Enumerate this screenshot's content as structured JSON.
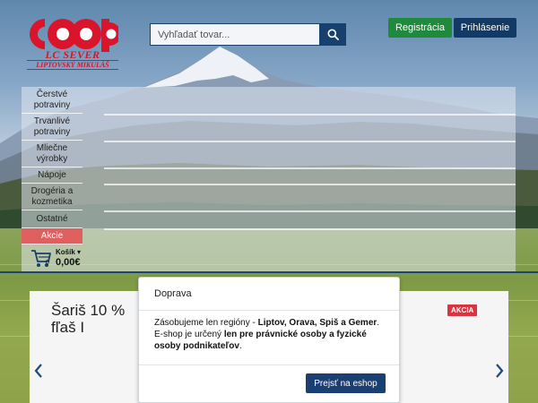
{
  "brand": {
    "logo_text": "coop",
    "subtitle": "LC SEVER",
    "location": "LIPTOVSKÝ MIKULÁŠ",
    "color": "#d9142b"
  },
  "search": {
    "placeholder": "Vyhľadať tovar...",
    "icon": "search-icon"
  },
  "auth": {
    "register_label": "Registrácia",
    "login_label": "Prihlásenie"
  },
  "categories": [
    {
      "label": "Čerstvé potraviny"
    },
    {
      "label": "Trvanlivé potraviny"
    },
    {
      "label": "Mliečne výrobky"
    },
    {
      "label": "Nápoje"
    },
    {
      "label": "Drogéria a kozmetika"
    },
    {
      "label": "Ostatné"
    },
    {
      "label": "Akcie"
    }
  ],
  "cart": {
    "title": "Košík",
    "count": "0",
    "total": "0,00€",
    "icon": "cart-icon"
  },
  "banner": {
    "text": "Šariš 10 % fľaš I",
    "badge": "AKCIA",
    "prev_icon": "chevron-left-icon",
    "next_icon": "chevron-right-icon"
  },
  "modal": {
    "title": "Doprava",
    "line1_prefix": "Zásobujeme len regióny - ",
    "line1_bold": "Liptov, Orava, Spiš a Gemer",
    "line1_suffix": ".",
    "line2_prefix": "E-shop je určený ",
    "line2_bold": "len pre právnické osoby a fyzické osoby podnikateľov",
    "line2_suffix": ".",
    "button_label": "Prejsť na eshop"
  },
  "colors": {
    "primary": "#16406e",
    "green": "#1f8a3c",
    "akcie": "#e06060",
    "badge": "#d9343f"
  }
}
